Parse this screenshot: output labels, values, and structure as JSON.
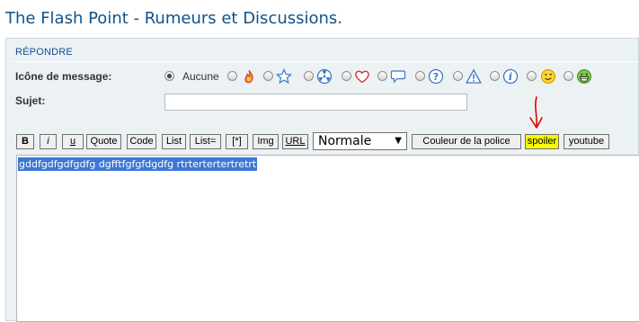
{
  "forum_title": "The Flash Point - Rumeurs et Discussions.",
  "panel": {
    "heading": "RÉPONDRE"
  },
  "message_icon": {
    "label": "Icône de message:",
    "none_label": "Aucune",
    "selected": "Aucune",
    "icons": [
      "flame-icon",
      "star-icon",
      "radioactive-icon",
      "heart-icon",
      "speech-bubble-icon",
      "question-icon",
      "warning-icon",
      "info-icon",
      "wink-smiley-icon",
      "grin-smiley-icon"
    ]
  },
  "subject": {
    "label": "Sujet:",
    "value": ""
  },
  "toolbar": {
    "bold": "B",
    "italic": "i",
    "underline": "u",
    "quote": "Quote",
    "code": "Code",
    "list": "List",
    "list_eq": "List=",
    "list_item": "[*]",
    "img": "Img",
    "url": "URL",
    "font_size": "Normale",
    "font_color": "Couleur de la police",
    "spoiler": "spoiler",
    "youtube": "youtube"
  },
  "editor": {
    "text": "gddfgdfgdfgdfg dgfftfgfgfdgdfg rtrtertertertretrt"
  },
  "colors": {
    "title": "#105289",
    "panel_bg": "#ecf1f3",
    "highlight": "#f6f900",
    "annotation": "#e00000",
    "selection": "#3d77d6"
  }
}
